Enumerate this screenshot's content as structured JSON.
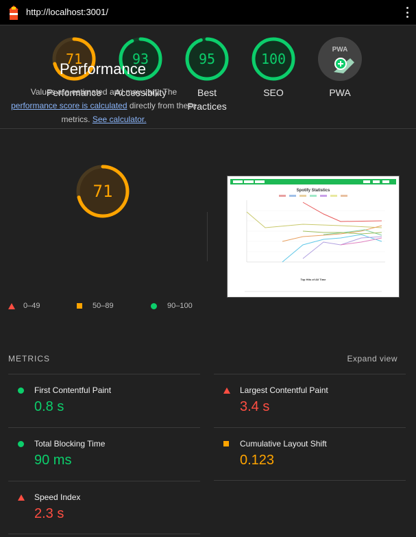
{
  "topbar": {
    "url": "http://localhost:3001/",
    "logo_icon": "lighthouse-icon",
    "menu_icon": "kebab-menu-icon"
  },
  "colors": {
    "pass": "#0cce6b",
    "average": "#ffa400",
    "fail": "#ff4e42",
    "bg": "#212121"
  },
  "gauges": [
    {
      "score": "71",
      "value": 0.71,
      "label": "Performance",
      "color": "#ffa400"
    },
    {
      "score": "93",
      "value": 0.93,
      "label": "Accessibility",
      "color": "#0cce6b"
    },
    {
      "score": "95",
      "value": 0.95,
      "label": "Best Practices",
      "color": "#0cce6b"
    },
    {
      "score": "100",
      "value": 1.0,
      "label": "SEO",
      "color": "#0cce6b"
    },
    {
      "score": "",
      "label": "PWA",
      "icon": "pwa-badge-icon"
    }
  ],
  "performance": {
    "score": "71",
    "value": 0.71,
    "title": "Performance",
    "desc_before": "Values are estimated and may vary. The ",
    "desc_link": "performance score is calculated",
    "desc_mid": " directly from these metrics. ",
    "desc_link2": "See calculator."
  },
  "legend": [
    {
      "range": "0–49",
      "shape": "triangle"
    },
    {
      "range": "50–89",
      "shape": "square"
    },
    {
      "range": "90–100",
      "shape": "circle"
    }
  ],
  "metrics": {
    "header": "METRICS",
    "expand_label": "Expand view",
    "items": [
      {
        "name": "First Contentful Paint",
        "value": "0.8 s",
        "status": "pass"
      },
      {
        "name": "Largest Contentful Paint",
        "value": "3.4 s",
        "status": "fail"
      },
      {
        "name": "Total Blocking Time",
        "value": "90 ms",
        "status": "pass"
      },
      {
        "name": "Cumulative Layout Shift",
        "value": "0.123",
        "status": "average"
      },
      {
        "name": "Speed Index",
        "value": "2.3 s",
        "status": "fail"
      }
    ]
  },
  "screenshot": {
    "chart_title": "Spotify Statistics",
    "table_title": "Top Hits of All Time"
  }
}
